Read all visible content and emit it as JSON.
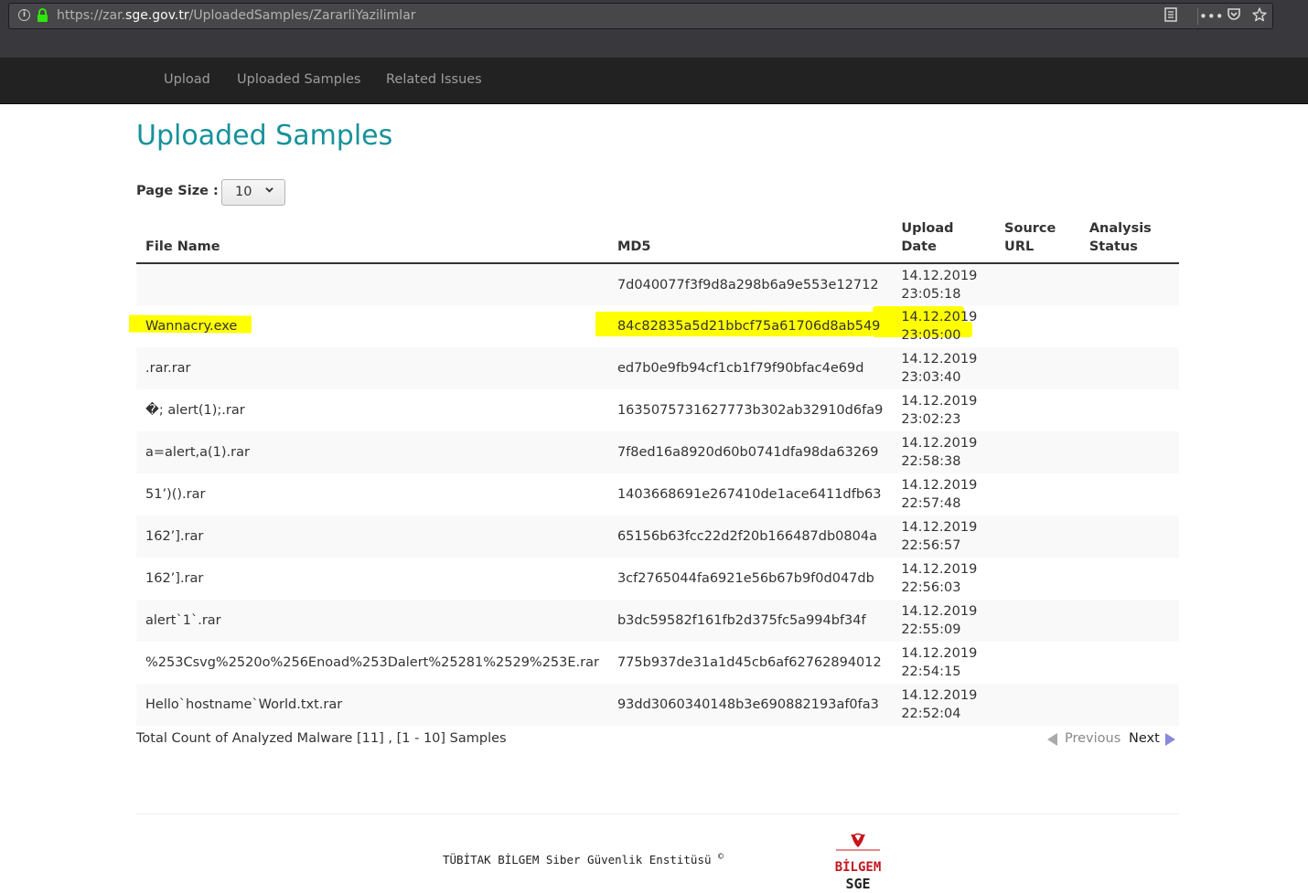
{
  "browser": {
    "url_prefix": "https://zar.",
    "url_host": "sge.gov.tr",
    "url_path": "/UploadedSamples/ZararliYazilimlar",
    "icons": [
      "info-icon",
      "lock-icon",
      "reader-view-icon",
      "more-icon",
      "pocket-icon",
      "bookmark-star-icon"
    ]
  },
  "nav": {
    "items": [
      {
        "label": "Upload"
      },
      {
        "label": "Uploaded Samples"
      },
      {
        "label": "Related Issues"
      }
    ]
  },
  "page": {
    "title": "Uploaded Samples",
    "page_size_label": "Page Size :",
    "page_size_value": "10"
  },
  "table": {
    "headers": {
      "file_name": "File Name",
      "md5": "MD5",
      "upload_date_1": "Upload",
      "upload_date_2": "Date",
      "source_url_1": "Source",
      "source_url_2": "URL",
      "analysis_status_1": "Analysis",
      "analysis_status_2": "Status"
    },
    "rows": [
      {
        "file_name": "",
        "md5": "7d040077f3f9d8a298b6a9e553e12712",
        "date": "14.12.2019",
        "time": "23:05:18"
      },
      {
        "file_name": "Wannacry.exe",
        "md5": "84c82835a5d21bbcf75a61706d8ab549",
        "date": "14.12.2019",
        "time": "23:05:00"
      },
      {
        "file_name": ".rar.rar",
        "md5": "ed7b0e9fb94cf1cb1f79f90bfac4e69d",
        "date": "14.12.2019",
        "time": "23:03:40"
      },
      {
        "file_name": "�; alert(1);.rar",
        "md5": "1635075731627773b302ab32910d6fa9",
        "date": "14.12.2019",
        "time": "23:02:23"
      },
      {
        "file_name": "a=alert,a(1).rar",
        "md5": "7f8ed16a8920d60b0741dfa98da63269",
        "date": "14.12.2019",
        "time": "22:58:38"
      },
      {
        "file_name": "51’)().rar",
        "md5": "1403668691e267410de1ace6411dfb63",
        "date": "14.12.2019",
        "time": "22:57:48"
      },
      {
        "file_name": "162’].rar",
        "md5": "65156b63fcc22d2f20b166487db0804a",
        "date": "14.12.2019",
        "time": "22:56:57"
      },
      {
        "file_name": "162’].rar",
        "md5": "3cf2765044fa6921e56b67b9f0d047db",
        "date": "14.12.2019",
        "time": "22:56:03"
      },
      {
        "file_name": "alert`1`.rar",
        "md5": "b3dc59582f161fb2d375fc5a994bf34f",
        "date": "14.12.2019",
        "time": "22:55:09"
      },
      {
        "file_name": "%253Csvg%2520o%256Enoad%253Dalert%25281%2529%253E.rar",
        "md5": "775b937de31a1d45cb6af62762894012",
        "date": "14.12.2019",
        "time": "22:54:15"
      },
      {
        "file_name": "Hello`hostname`World.txt.rar",
        "md5": "93dd3060340148b3e690882193af0fa3",
        "date": "14.12.2019",
        "time": "22:52:04"
      }
    ]
  },
  "pager": {
    "total_text": "Total Count of Analyzed Malware [11] , [1 - 10] Samples",
    "previous": "Previous",
    "next": "Next"
  },
  "footer": {
    "text": "TÜBİTAK BİLGEM Siber Güvenlik Enstitüsü",
    "copyright": "©",
    "logo_line1": "BİLGEM",
    "logo_line2": "SGE"
  },
  "colors": {
    "title": "#17919a",
    "navbar": "#222222",
    "highlight": "#ffff00",
    "logo_red": "#c4161c"
  }
}
